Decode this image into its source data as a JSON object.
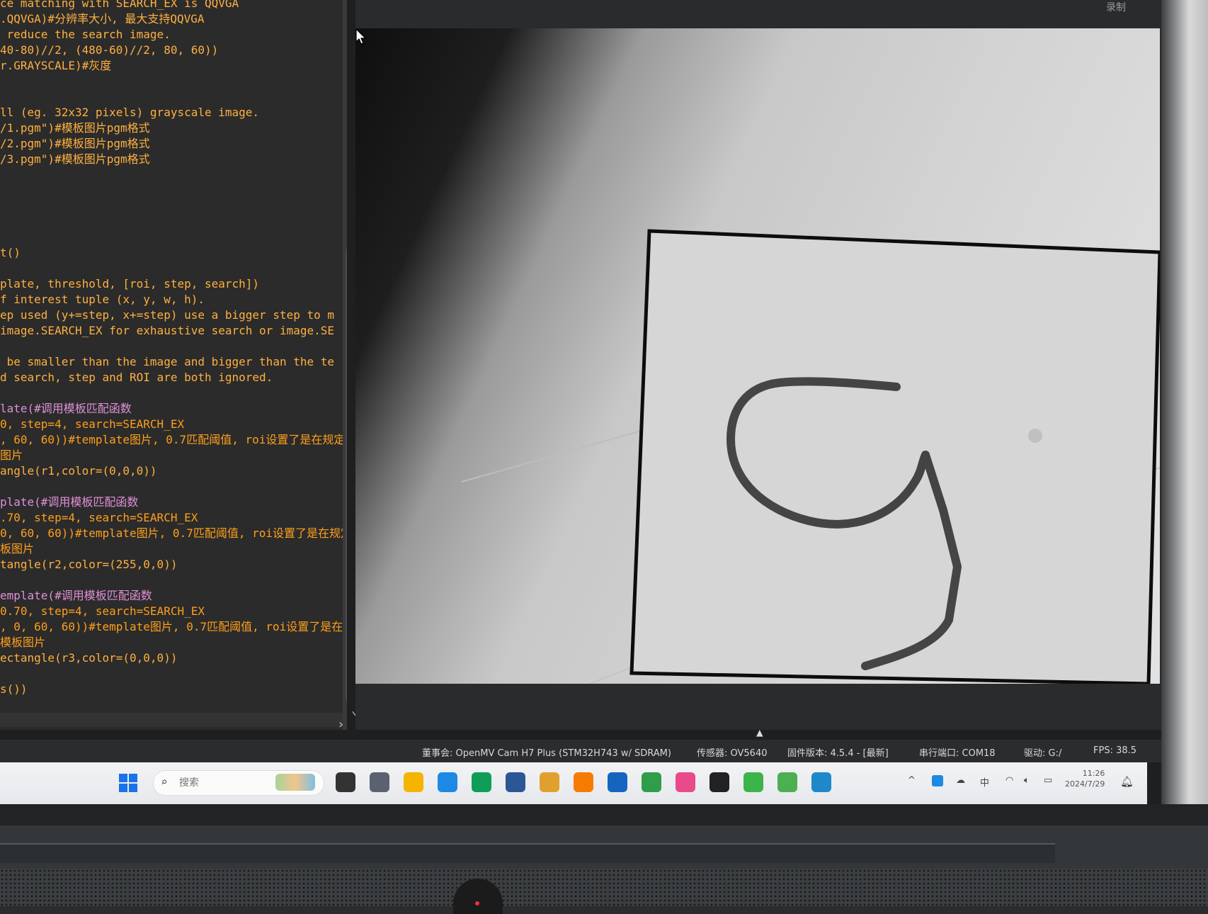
{
  "editor": {
    "code_lines": [
      {
        "text": "ce matching with SEARCH_EX is QQVGA",
        "kind": "c"
      },
      {
        "text": ".QQVGA)#分辨率大小, 最大支持QQVGA",
        "kind": "c"
      },
      {
        "text": " reduce the search image.",
        "kind": "c"
      },
      {
        "text": "40-80)//2, (480-60)//2, 80, 60))",
        "kind": "c"
      },
      {
        "text": "r.GRAYSCALE)#灰度",
        "kind": "c"
      },
      {
        "text": "",
        "kind": "c"
      },
      {
        "text": "",
        "kind": "c"
      },
      {
        "text": "ll (eg. 32x32 pixels) grayscale image.",
        "kind": "c"
      },
      {
        "text": "/1.pgm\")#模板图片pgm格式",
        "kind": "c"
      },
      {
        "text": "/2.pgm\")#模板图片pgm格式",
        "kind": "c"
      },
      {
        "text": "/3.pgm\")#模板图片pgm格式",
        "kind": "c"
      },
      {
        "text": "",
        "kind": "c"
      },
      {
        "text": "",
        "kind": "c"
      },
      {
        "text": "",
        "kind": "c"
      },
      {
        "text": "",
        "kind": "c"
      },
      {
        "text": "",
        "kind": "c"
      },
      {
        "text": "t()",
        "kind": "c"
      },
      {
        "text": "",
        "kind": "c"
      },
      {
        "text": "plate, threshold, [roi, step, search])",
        "kind": "c"
      },
      {
        "text": "f interest tuple (x, y, w, h).",
        "kind": "c"
      },
      {
        "text": "ep used (y+=step, x+=step) use a bigger step to m",
        "kind": "c"
      },
      {
        "text": "image.SEARCH_EX for exhaustive search or image.SE",
        "kind": "c"
      },
      {
        "text": "",
        "kind": "c"
      },
      {
        "text": " be smaller than the image and bigger than the te",
        "kind": "c"
      },
      {
        "text": "d search, step and ROI are both ignored.",
        "kind": "c"
      },
      {
        "text": "",
        "kind": "c"
      },
      {
        "text": "late(#调用模板匹配函数",
        "kind": "p"
      },
      {
        "text": "0, step=4, search=SEARCH_EX",
        "kind": "k"
      },
      {
        "text": ", 60, 60))#template图片, 0.7匹配阈值, roi设置了是在规定区",
        "kind": "k"
      },
      {
        "text": "图片",
        "kind": "k"
      },
      {
        "text": "angle(r1,color=(0,0,0))",
        "kind": "c"
      },
      {
        "text": "",
        "kind": "c"
      },
      {
        "text": "plate(#调用模板匹配函数",
        "kind": "p"
      },
      {
        "text": ".70, step=4, search=SEARCH_EX",
        "kind": "k"
      },
      {
        "text": "0, 60, 60))#template图片, 0.7匹配阈值, roi设置了是在规定区",
        "kind": "k"
      },
      {
        "text": "板图片",
        "kind": "k"
      },
      {
        "text": "tangle(r2,color=(255,0,0))",
        "kind": "c"
      },
      {
        "text": "",
        "kind": "c"
      },
      {
        "text": "emplate(#调用模板匹配函数",
        "kind": "p"
      },
      {
        "text": "0.70, step=4, search=SEARCH_EX",
        "kind": "k"
      },
      {
        "text": ", 0, 60, 60))#template图片, 0.7匹配阈值, roi设置了是在规定区",
        "kind": "k"
      },
      {
        "text": "模板图片",
        "kind": "k"
      },
      {
        "text": "ectangle(r3,color=(0,0,0))",
        "kind": "c"
      },
      {
        "text": "",
        "kind": "c"
      },
      {
        "text": "s())",
        "kind": "c"
      }
    ]
  },
  "framebuffer": {
    "top_label": "录制",
    "image_content": "handwritten digit 9 inside a black rectangle"
  },
  "statusbar": {
    "board": "董事会: OpenMV Cam H7 Plus (STM32H743 w/ SDRAM)",
    "sensor": "传感器: OV5640",
    "firmware": "固件版本: 4.5.4 - [最新]",
    "port": "串行端口: COM18",
    "drive": "驱动: G:/",
    "fps": "FPS: 38.5"
  },
  "taskbar": {
    "search_placeholder": "搜索",
    "apps": [
      {
        "name": "task-view",
        "color": "#333333"
      },
      {
        "name": "widgets",
        "color": "#5a6270"
      },
      {
        "name": "file-explorer",
        "color": "#f4b400"
      },
      {
        "name": "ie",
        "color": "#1e88e5"
      },
      {
        "name": "edge",
        "color": "#0f9d58"
      },
      {
        "name": "store",
        "color": "#2b5797"
      },
      {
        "name": "app-yellow",
        "color": "#e0a030"
      },
      {
        "name": "app-orange",
        "color": "#f57c00"
      },
      {
        "name": "app-k",
        "color": "#1565c0"
      },
      {
        "name": "app-green",
        "color": "#2e9e4a"
      },
      {
        "name": "app-pink",
        "color": "#e84a8a"
      },
      {
        "name": "app-dark",
        "color": "#222222"
      },
      {
        "name": "wechat",
        "color": "#3bb54a"
      },
      {
        "name": "app-monitor",
        "color": "#4caf50"
      },
      {
        "name": "openmv-ide",
        "color": "#1e88c8"
      }
    ],
    "tray": {
      "chevron": "^",
      "ime": "中",
      "time": "11:26",
      "date": "2024/7/29"
    }
  },
  "colors": {
    "code_default": "#f0a030",
    "code_keyword": "#ff9f1c",
    "code_purple": "#e090d8",
    "taskbar_bg": "#eef0f3",
    "statusbar_bg": "#2b2c2e"
  }
}
